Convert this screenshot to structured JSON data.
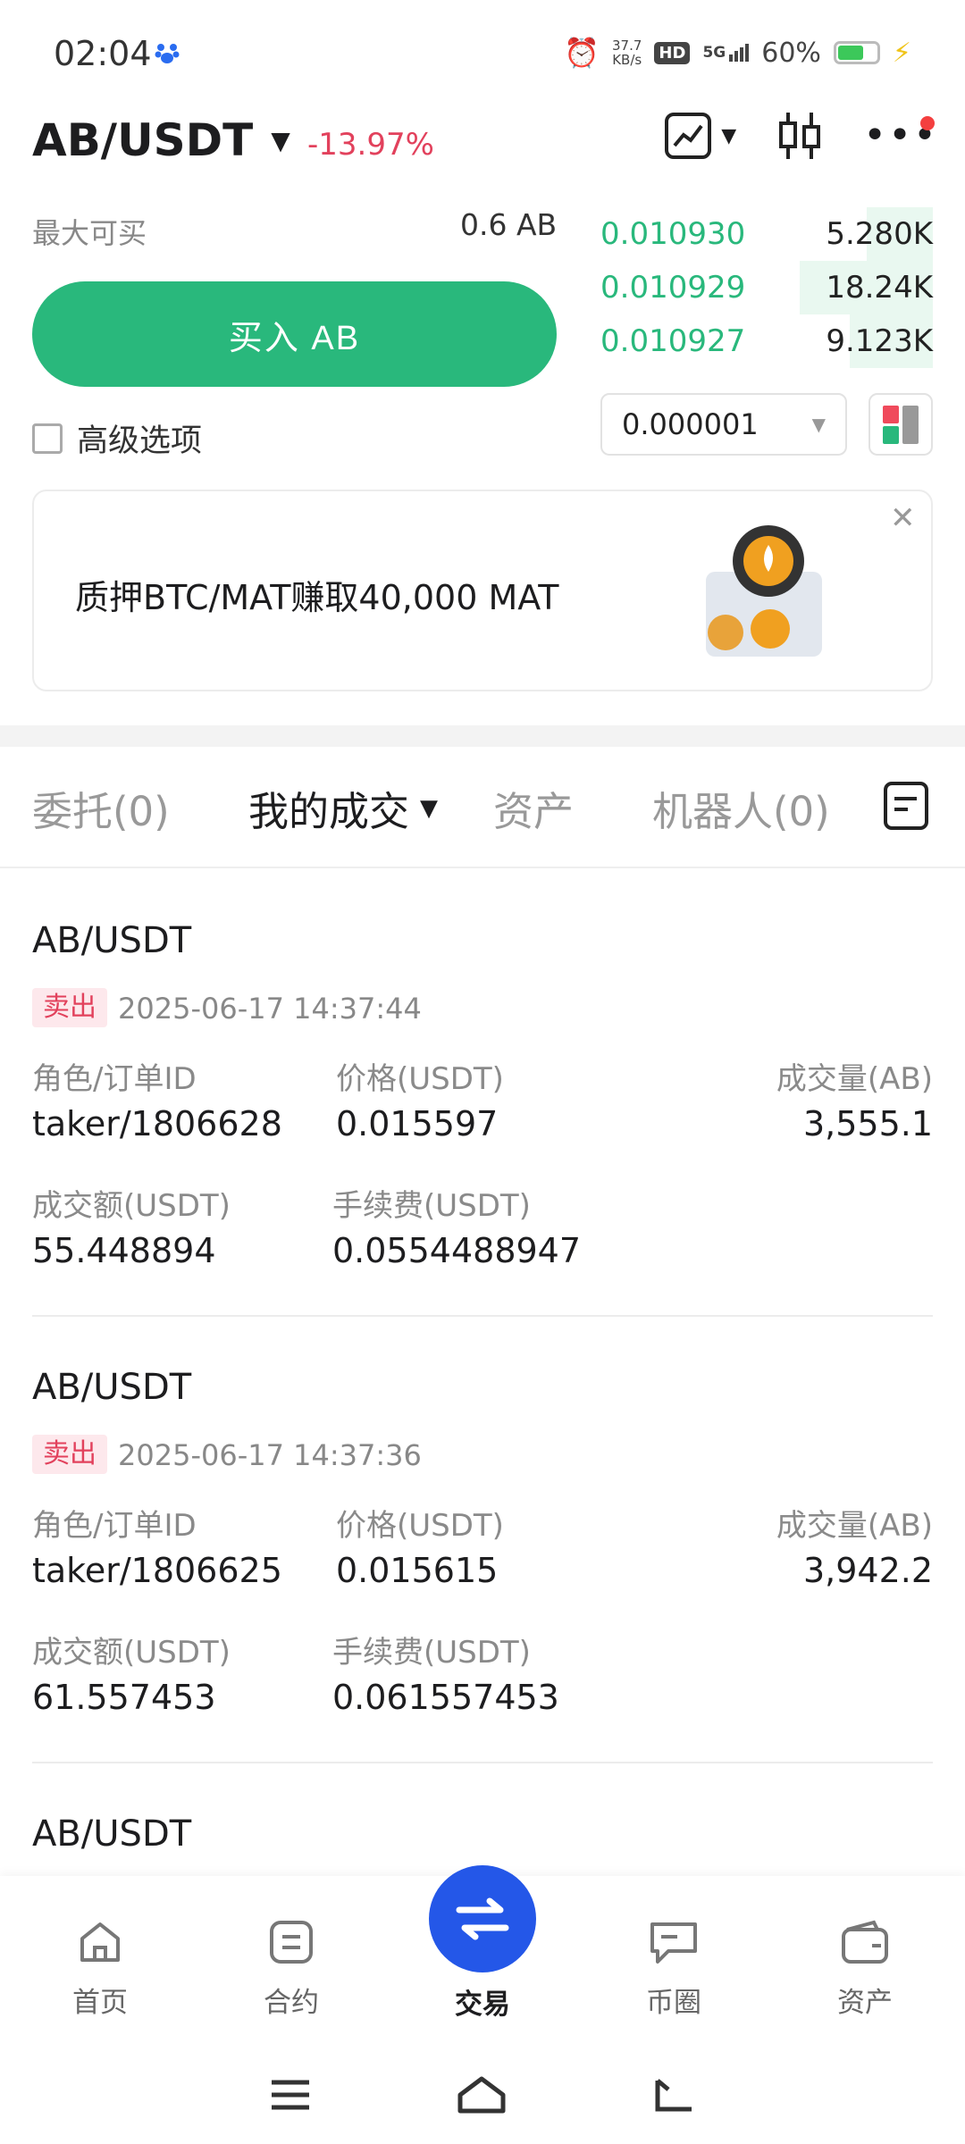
{
  "status": {
    "time": "02:04",
    "net_speed_top": "37.7",
    "net_speed_bottom": "KB/s",
    "hd": "HD",
    "signal": "5G",
    "battery": "60%",
    "battery_level": 0.6
  },
  "header": {
    "pair": "AB/USDT",
    "change": "-13.97%"
  },
  "trade": {
    "max_buy_label": "最大可买",
    "max_buy_value": "0.6 AB",
    "buy_button": "买入 AB",
    "advanced_label": "高级选项"
  },
  "orderbook": {
    "rows": [
      {
        "price": "0.010930",
        "qty": "5.280K",
        "depth": 0.2
      },
      {
        "price": "0.010929",
        "qty": "18.24K",
        "depth": 0.4
      },
      {
        "price": "0.010927",
        "qty": "9.123K",
        "depth": 0.25
      }
    ],
    "precision": "0.000001"
  },
  "banner": {
    "text": "质押BTC/MAT赚取40,000 MAT"
  },
  "tabs": [
    {
      "label": "委托(0)"
    },
    {
      "label": "我的成交"
    },
    {
      "label": "资产"
    },
    {
      "label": "机器人(0)"
    }
  ],
  "trades": [
    {
      "pair": "AB/USDT",
      "side": "卖出",
      "time": "2025-06-17 14:37:44",
      "role_label": "角色/订单ID",
      "role": "taker/1806628",
      "price_label": "价格(USDT)",
      "price": "0.015597",
      "volume_label": "成交量(AB)",
      "volume": "3,555.1",
      "amount_label": "成交额(USDT)",
      "amount": "55.448894",
      "fee_label": "手续费(USDT)",
      "fee": "0.0554488947"
    },
    {
      "pair": "AB/USDT",
      "side": "卖出",
      "time": "2025-06-17 14:37:36",
      "role_label": "角色/订单ID",
      "role": "taker/1806625",
      "price_label": "价格(USDT)",
      "price": "0.015615",
      "volume_label": "成交量(AB)",
      "volume": "3,942.2",
      "amount_label": "成交额(USDT)",
      "amount": "61.557453",
      "fee_label": "手续费(USDT)",
      "fee": "0.061557453"
    },
    {
      "pair": "AB/USDT"
    }
  ],
  "nav": {
    "home": "首页",
    "contract": "合约",
    "trade": "交易",
    "community": "币圈",
    "assets": "资产"
  },
  "colors": {
    "buy_green": "#29b87c",
    "sell_red": "#e2415c",
    "nav_blue": "#2457e8"
  }
}
